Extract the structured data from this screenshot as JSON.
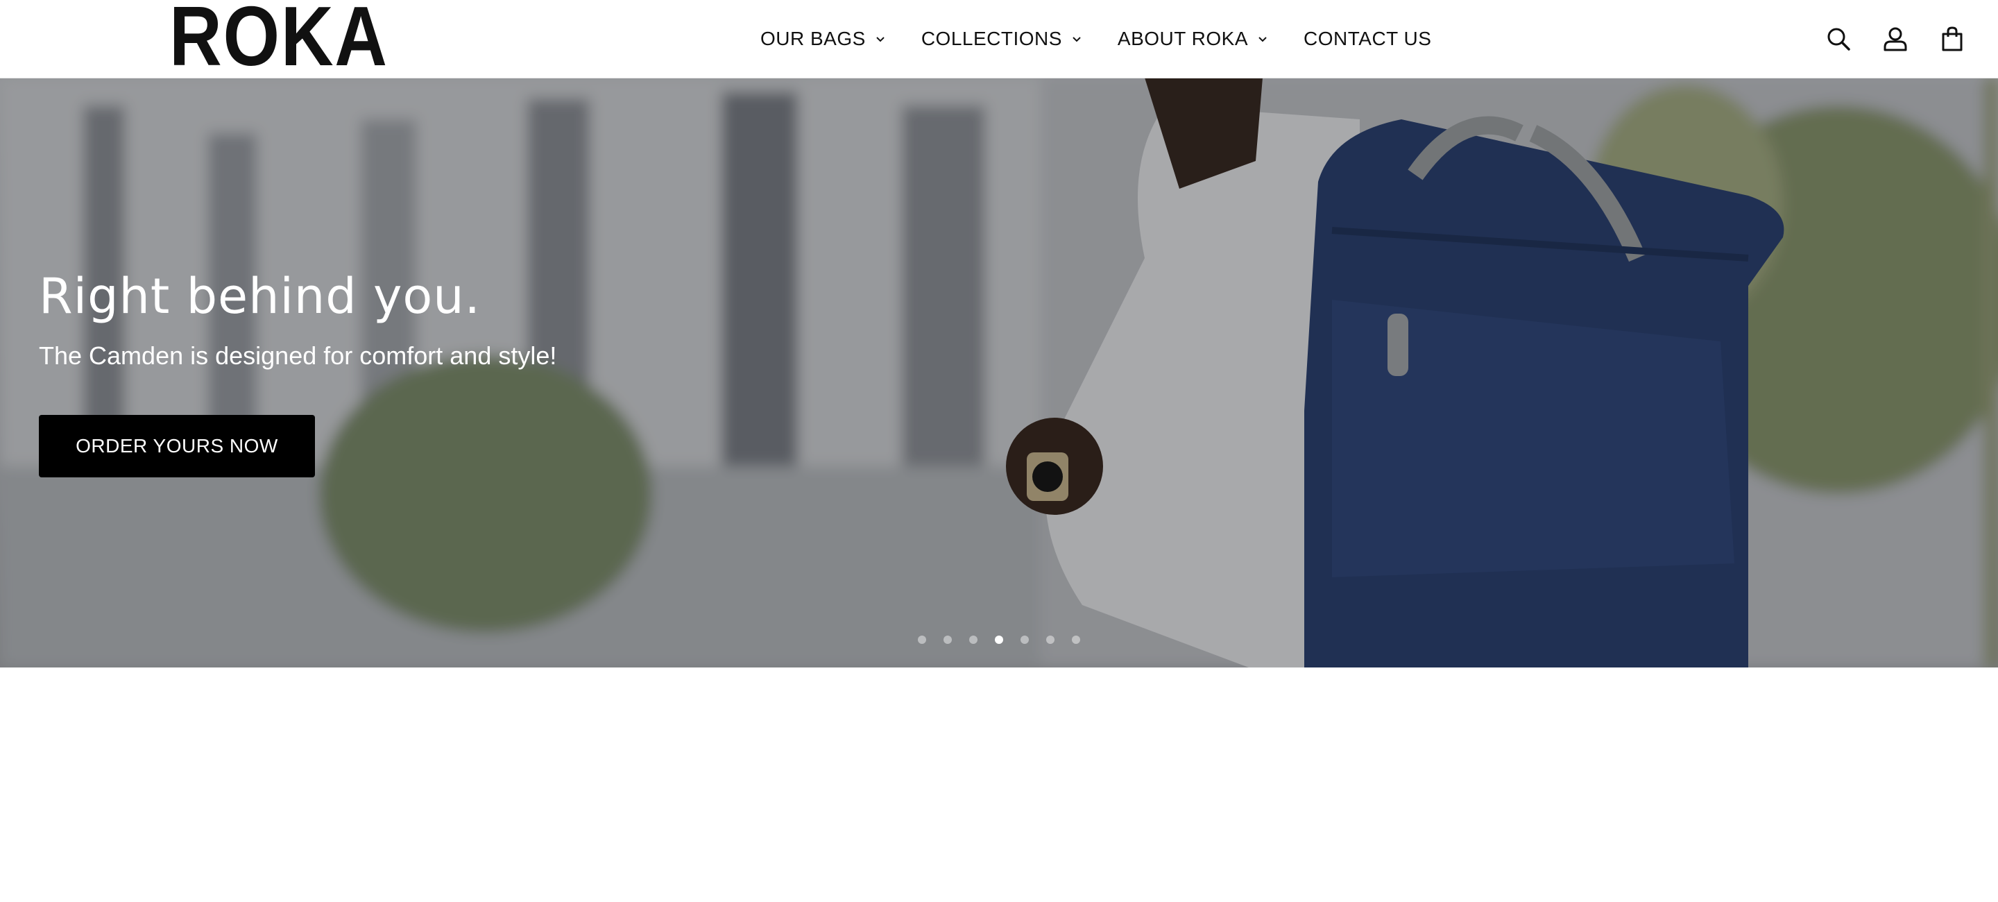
{
  "brand": {
    "logo_text": "ROKA"
  },
  "nav": {
    "items": [
      {
        "label": "OUR BAGS",
        "has_dropdown": true
      },
      {
        "label": "COLLECTIONS",
        "has_dropdown": true
      },
      {
        "label": "ABOUT ROKA",
        "has_dropdown": true
      },
      {
        "label": "CONTACT US",
        "has_dropdown": false
      }
    ]
  },
  "header_icons": [
    "search-icon",
    "account-icon",
    "cart-icon"
  ],
  "hero": {
    "heading": "Right behind you.",
    "subheading": "The Camden is designed for comfort and style!",
    "cta_label": "ORDER YOURS NOW",
    "slide_count": 7,
    "active_slide": 4
  },
  "colors": {
    "header_bg": "#ffffff",
    "cta_bg": "#000000",
    "bag_blue": "#2d4373"
  }
}
